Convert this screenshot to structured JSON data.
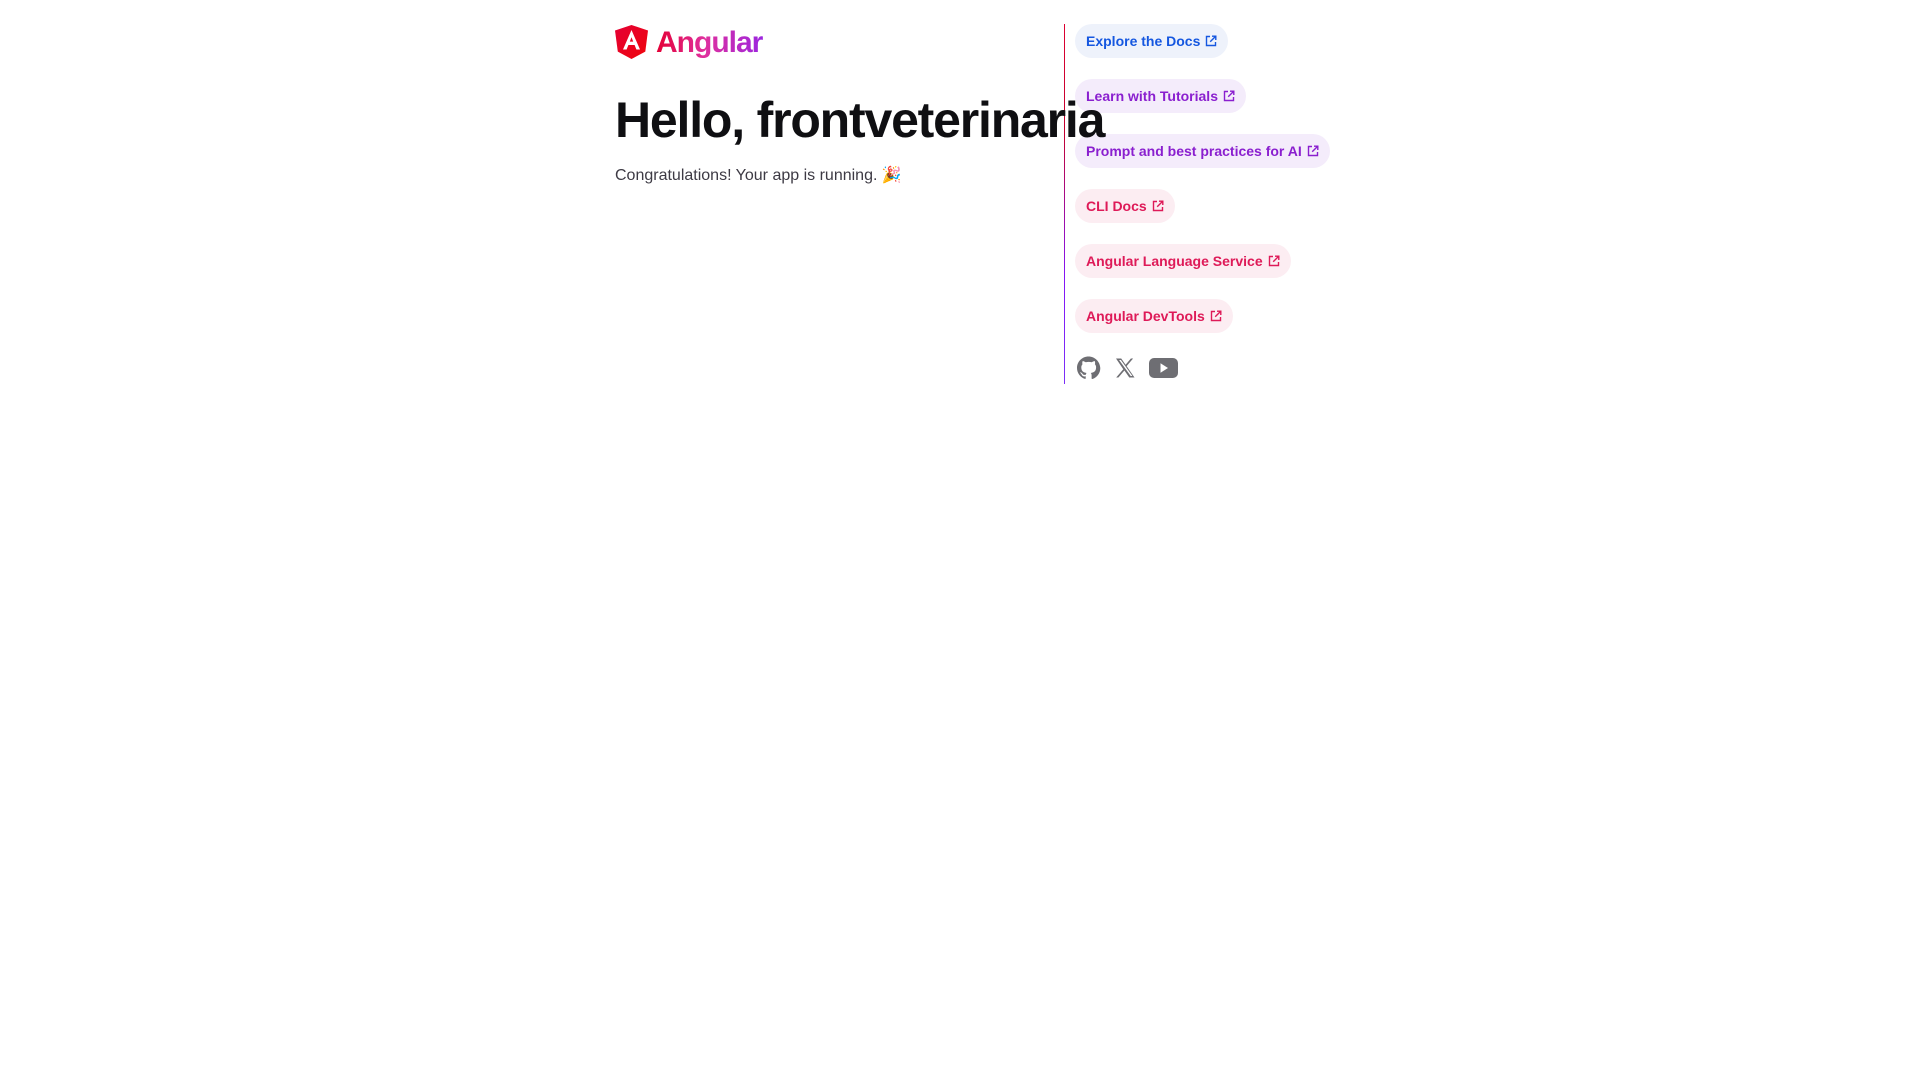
{
  "brand": {
    "name": "Angular",
    "colors": {
      "red": "#dd0031",
      "pink": "#e0309e",
      "purple": "#9b25e0"
    }
  },
  "hero": {
    "title": "Hello, frontveterinaria",
    "subtitle": "Congratulations! Your app is running. 🎉"
  },
  "links": [
    {
      "label": "Explore the Docs",
      "icon": "external-link-icon",
      "color": "#1557e0"
    },
    {
      "label": "Learn with Tutorials",
      "icon": "external-link-icon",
      "color": "#8a1fcf"
    },
    {
      "label": "Prompt and best practices for AI",
      "icon": "external-link-icon",
      "color": "#8a1fcf"
    },
    {
      "label": "CLI Docs",
      "icon": "external-link-icon",
      "color": "#de1a58"
    },
    {
      "label": "Angular Language Service",
      "icon": "external-link-icon",
      "color": "#de1a58"
    },
    {
      "label": "Angular DevTools",
      "icon": "external-link-icon",
      "color": "#de1a58"
    }
  ],
  "socials": [
    {
      "icon": "github-icon"
    },
    {
      "icon": "x-twitter-icon"
    },
    {
      "icon": "youtube-icon"
    }
  ]
}
